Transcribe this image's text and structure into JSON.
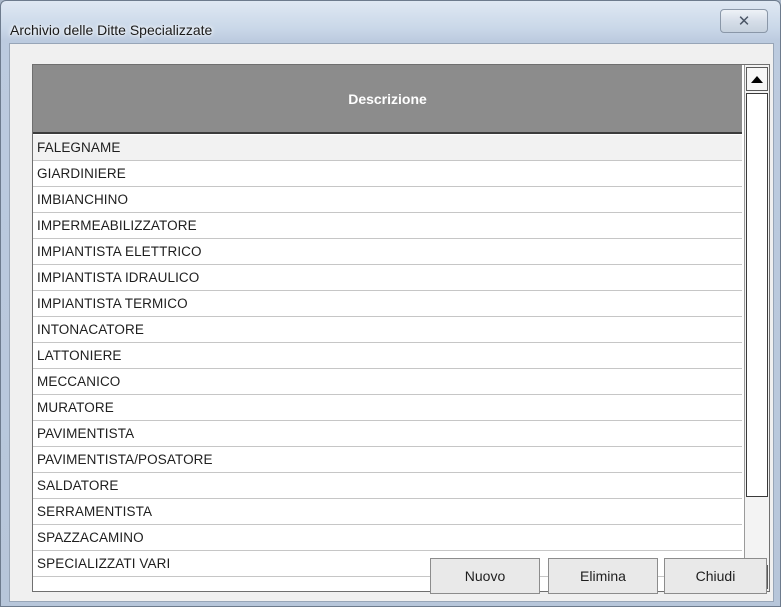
{
  "window": {
    "title": "Archivio delle Ditte Specializzate",
    "close_glyph": "✕"
  },
  "grid": {
    "column_header": "Descrizione",
    "rows": [
      "FALEGNAME",
      "GIARDINIERE",
      "IMBIANCHINO",
      "IMPERMEABILIZZATORE",
      "IMPIANTISTA ELETTRICO",
      "IMPIANTISTA IDRAULICO",
      "IMPIANTISTA TERMICO",
      "INTONACATORE",
      "LATTONIERE",
      "MECCANICO",
      "MURATORE",
      "PAVIMENTISTA",
      "PAVIMENTISTA/POSATORE",
      "SALDATORE",
      "SERRAMENTISTA",
      "SPAZZACAMINO",
      "SPECIALIZZATI VARI"
    ]
  },
  "buttons": {
    "new_label": "Nuovo",
    "delete_label": "Elimina",
    "close_label": "Chiudi"
  }
}
